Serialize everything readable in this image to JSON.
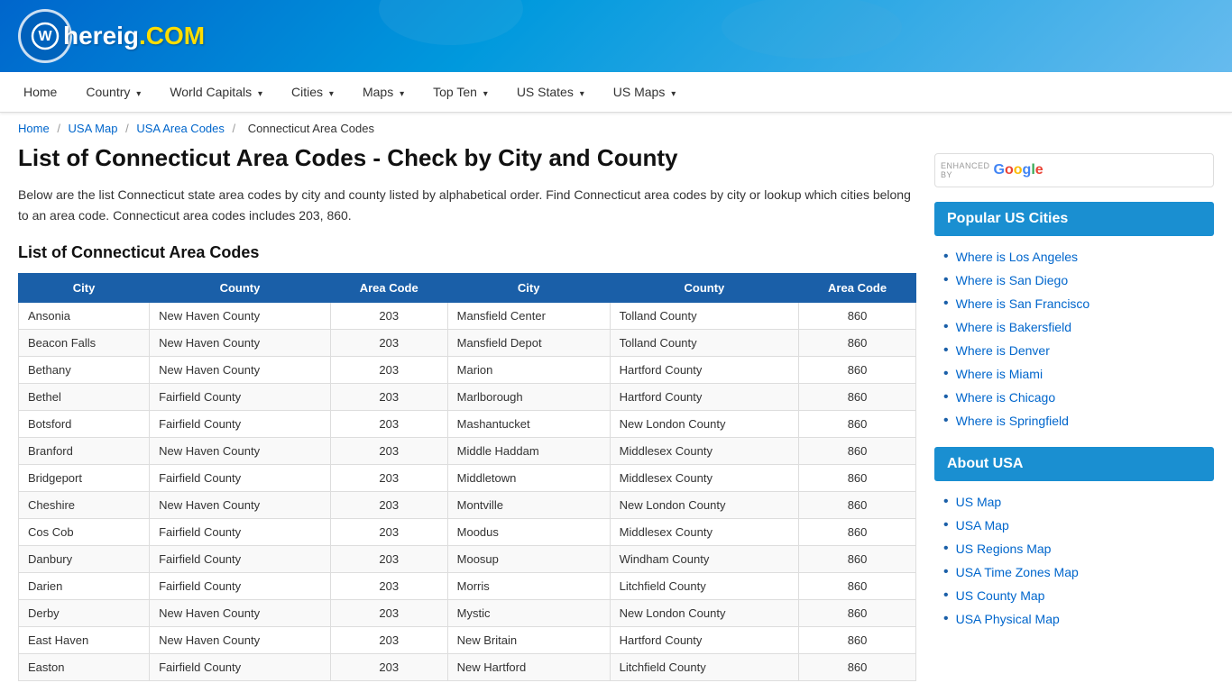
{
  "site": {
    "name": "Whereig",
    "tld": ".COM",
    "logo_letter": "W"
  },
  "nav": {
    "items": [
      {
        "label": "Home",
        "has_arrow": false
      },
      {
        "label": "Country",
        "has_arrow": true
      },
      {
        "label": "World Capitals",
        "has_arrow": true
      },
      {
        "label": "Cities",
        "has_arrow": true
      },
      {
        "label": "Maps",
        "has_arrow": true
      },
      {
        "label": "Top Ten",
        "has_arrow": true
      },
      {
        "label": "US States",
        "has_arrow": true
      },
      {
        "label": "US Maps",
        "has_arrow": true
      }
    ]
  },
  "breadcrumb": {
    "items": [
      {
        "label": "Home",
        "link": true
      },
      {
        "label": "USA Map",
        "link": true
      },
      {
        "label": "USA Area Codes",
        "link": true
      },
      {
        "label": "Connecticut Area Codes",
        "link": false
      }
    ]
  },
  "page": {
    "title": "List of Connecticut Area Codes - Check by City and County",
    "description": "Below are the list Connecticut state area codes by city and county listed by alphabetical order. Find Connecticut area codes by city or lookup which cities belong to an area code. Connecticut area codes includes 203, 860.",
    "section_title": "List of Connecticut Area Codes"
  },
  "table": {
    "headers": [
      "City",
      "County",
      "Area Code",
      "City",
      "County",
      "Area Code"
    ],
    "rows": [
      [
        "Ansonia",
        "New Haven County",
        "203",
        "Mansfield Center",
        "Tolland County",
        "860"
      ],
      [
        "Beacon Falls",
        "New Haven County",
        "203",
        "Mansfield Depot",
        "Tolland County",
        "860"
      ],
      [
        "Bethany",
        "New Haven County",
        "203",
        "Marion",
        "Hartford County",
        "860"
      ],
      [
        "Bethel",
        "Fairfield County",
        "203",
        "Marlborough",
        "Hartford County",
        "860"
      ],
      [
        "Botsford",
        "Fairfield County",
        "203",
        "Mashantucket",
        "New London County",
        "860"
      ],
      [
        "Branford",
        "New Haven County",
        "203",
        "Middle Haddam",
        "Middlesex County",
        "860"
      ],
      [
        "Bridgeport",
        "Fairfield County",
        "203",
        "Middletown",
        "Middlesex County",
        "860"
      ],
      [
        "Cheshire",
        "New Haven County",
        "203",
        "Montville",
        "New London County",
        "860"
      ],
      [
        "Cos Cob",
        "Fairfield County",
        "203",
        "Moodus",
        "Middlesex County",
        "860"
      ],
      [
        "Danbury",
        "Fairfield County",
        "203",
        "Moosup",
        "Windham County",
        "860"
      ],
      [
        "Darien",
        "Fairfield County",
        "203",
        "Morris",
        "Litchfield County",
        "860"
      ],
      [
        "Derby",
        "New Haven County",
        "203",
        "Mystic",
        "New London County",
        "860"
      ],
      [
        "East Haven",
        "New Haven County",
        "203",
        "New Britain",
        "Hartford County",
        "860"
      ],
      [
        "Easton",
        "Fairfield County",
        "203",
        "New Hartford",
        "Litchfield County",
        "860"
      ]
    ]
  },
  "sidebar": {
    "search": {
      "label": "ENHANCED BY",
      "google_text": "Google",
      "button_icon": "🔍",
      "placeholder": ""
    },
    "popular_section": {
      "title": "Popular US Cities",
      "links": [
        "Where is Los Angeles",
        "Where is San Diego",
        "Where is San Francisco",
        "Where is Bakersfield",
        "Where is Denver",
        "Where is Miami",
        "Where is Chicago",
        "Where is Springfield"
      ]
    },
    "about_section": {
      "title": "About USA",
      "links": [
        "US Map",
        "USA Map",
        "US Regions Map",
        "USA Time Zones Map",
        "US County Map",
        "USA Physical Map"
      ]
    }
  }
}
